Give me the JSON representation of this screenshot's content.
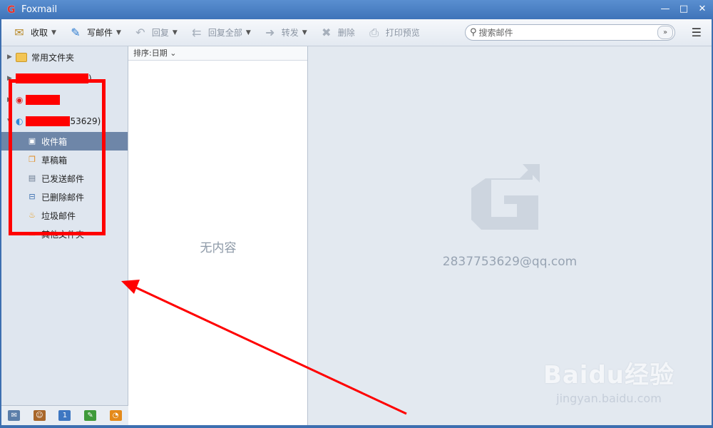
{
  "window": {
    "title": "Foxmail",
    "minimize": "—",
    "maximize": "□",
    "close": "✕"
  },
  "toolbar": {
    "items": [
      {
        "label": "收取",
        "icon": "✉",
        "dropdown": true,
        "enabled": true
      },
      {
        "label": "写邮件",
        "icon": "✎",
        "dropdown": true,
        "enabled": true
      },
      {
        "label": "回复",
        "icon": "↶",
        "dropdown": true,
        "enabled": false
      },
      {
        "label": "回复全部",
        "icon": "⇇",
        "dropdown": true,
        "enabled": false
      },
      {
        "label": "转发",
        "icon": "➜",
        "dropdown": true,
        "enabled": false
      },
      {
        "label": "删除",
        "icon": "✖",
        "dropdown": false,
        "enabled": false
      },
      {
        "label": "打印预览",
        "icon": "⎙",
        "dropdown": false,
        "enabled": false
      }
    ],
    "search_placeholder": "搜索邮件"
  },
  "sidebar": {
    "common_folder": "常用文件夹",
    "account1_suffix": ")",
    "account3_suffix": "53629)",
    "folders": [
      {
        "label": "收件箱",
        "icon": "inbox-icon",
        "glyph": "▣",
        "selected": true
      },
      {
        "label": "草稿箱",
        "icon": "drafts-icon",
        "glyph": "❐",
        "selected": false
      },
      {
        "label": "已发送邮件",
        "icon": "sent-icon",
        "glyph": "▤",
        "selected": false
      },
      {
        "label": "已删除邮件",
        "icon": "trash-icon",
        "glyph": "⊟",
        "selected": false
      },
      {
        "label": "垃圾邮件",
        "icon": "junk-icon",
        "glyph": "♨",
        "selected": false
      },
      {
        "label": "其他文件夹",
        "icon": "folder-icon",
        "glyph": "▭",
        "selected": false
      }
    ]
  },
  "list": {
    "sort_label": "排序:日期",
    "empty_text": "无内容"
  },
  "preview": {
    "account_email": "2837753629@qq.com"
  },
  "watermark": {
    "main": "Baidu经验",
    "sub": "jingyan.baidu.com"
  }
}
